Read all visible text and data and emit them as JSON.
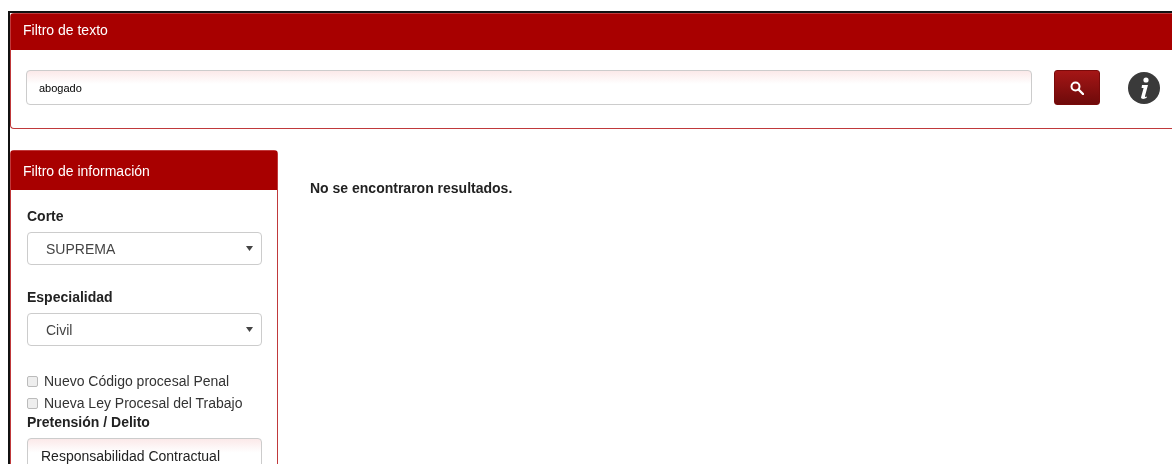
{
  "text_filter": {
    "title": "Filtro de texto",
    "query": "abogado"
  },
  "info_filter": {
    "title": "Filtro de información",
    "fields": [
      {
        "kind": "select",
        "label": "Corte",
        "value": "SUPREMA"
      },
      {
        "kind": "select",
        "label": "Especialidad",
        "value": "Civil"
      },
      {
        "kind": "checkbox",
        "label": "Nuevo Código procesal Penal",
        "checked": false
      },
      {
        "kind": "checkbox",
        "label": "Nueva Ley Procesal del Trabajo",
        "checked": false
      },
      {
        "kind": "text",
        "label": "Pretensión / Delito",
        "value": "Responsabilidad Contractual"
      }
    ]
  },
  "results": {
    "message": "No se encontraron resultados."
  }
}
